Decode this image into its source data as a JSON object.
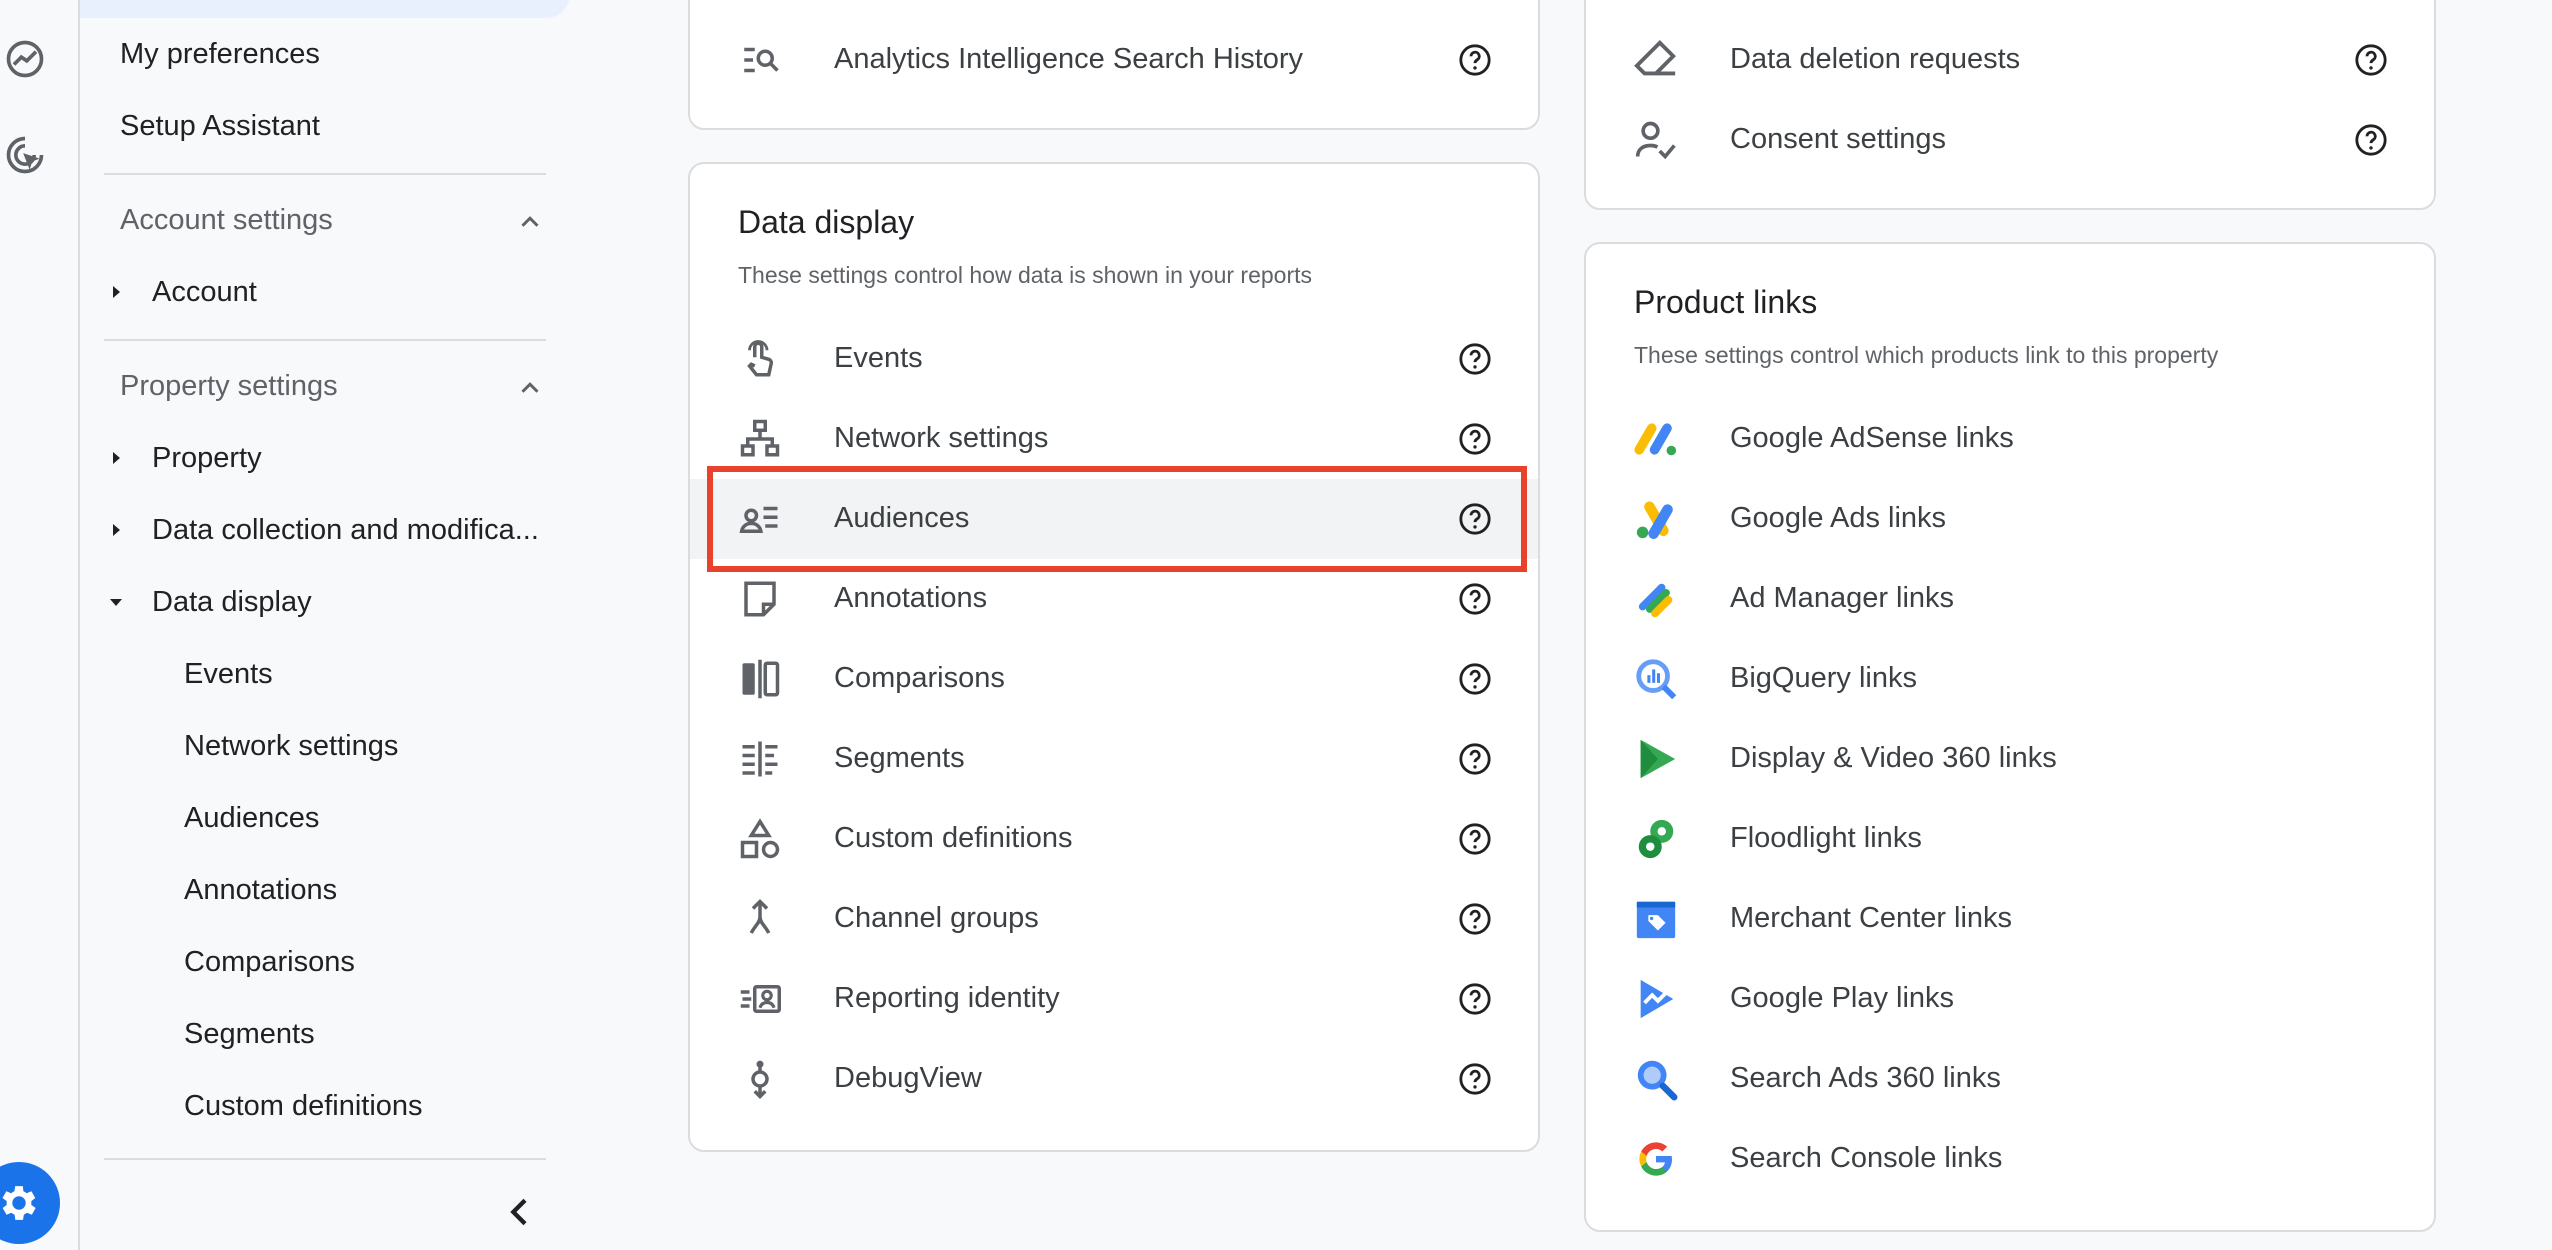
{
  "nav": {
    "items_top": [
      "My preferences",
      "Setup Assistant"
    ],
    "account_section": "Account settings",
    "account_items": [
      "Account"
    ],
    "property_section": "Property settings",
    "property_items": [
      "Property",
      "Data collection and modifica...",
      "Data display"
    ],
    "data_display_subitems": [
      "Events",
      "Network settings",
      "Audiences",
      "Annotations",
      "Comparisons",
      "Segments",
      "Custom definitions"
    ]
  },
  "top_card_left": {
    "rows": [
      {
        "label": "Analytics Intelligence Search History",
        "icon": "search-history-icon"
      }
    ]
  },
  "data_display_card": {
    "title": "Data display",
    "subtitle": "These settings control how data is shown in your reports",
    "rows": [
      {
        "label": "Events",
        "icon": "touch-icon"
      },
      {
        "label": "Network settings",
        "icon": "network-icon"
      },
      {
        "label": "Audiences",
        "icon": "audiences-icon"
      },
      {
        "label": "Annotations",
        "icon": "note-icon"
      },
      {
        "label": "Comparisons",
        "icon": "comparisons-icon"
      },
      {
        "label": "Segments",
        "icon": "segments-icon"
      },
      {
        "label": "Custom definitions",
        "icon": "shapes-icon"
      },
      {
        "label": "Channel groups",
        "icon": "merge-icon"
      },
      {
        "label": "Reporting identity",
        "icon": "identity-icon"
      },
      {
        "label": "DebugView",
        "icon": "debug-icon"
      }
    ],
    "selected": "Audiences"
  },
  "top_card_right": {
    "rows": [
      {
        "label": "Data deletion requests",
        "icon": "eraser-icon"
      },
      {
        "label": "Consent settings",
        "icon": "consent-icon"
      }
    ]
  },
  "product_links_card": {
    "title": "Product links",
    "subtitle": "These settings control which products link to this property",
    "rows": [
      {
        "label": "Google AdSense links",
        "icon": "adsense-icon"
      },
      {
        "label": "Google Ads links",
        "icon": "google-ads-icon"
      },
      {
        "label": "Ad Manager links",
        "icon": "ad-manager-icon"
      },
      {
        "label": "BigQuery links",
        "icon": "bigquery-icon"
      },
      {
        "label": "Display & Video 360 links",
        "icon": "dv360-icon"
      },
      {
        "label": "Floodlight links",
        "icon": "floodlight-icon"
      },
      {
        "label": "Merchant Center links",
        "icon": "merchant-center-icon"
      },
      {
        "label": "Google Play links",
        "icon": "google-play-icon"
      },
      {
        "label": "Search Ads 360 links",
        "icon": "search-ads-icon"
      },
      {
        "label": "Search Console links",
        "icon": "google-g-icon"
      }
    ]
  },
  "colors": {
    "accent": "#1a73e8",
    "highlight": "#e8412c",
    "text": "#202124",
    "muted": "#5f6368"
  }
}
